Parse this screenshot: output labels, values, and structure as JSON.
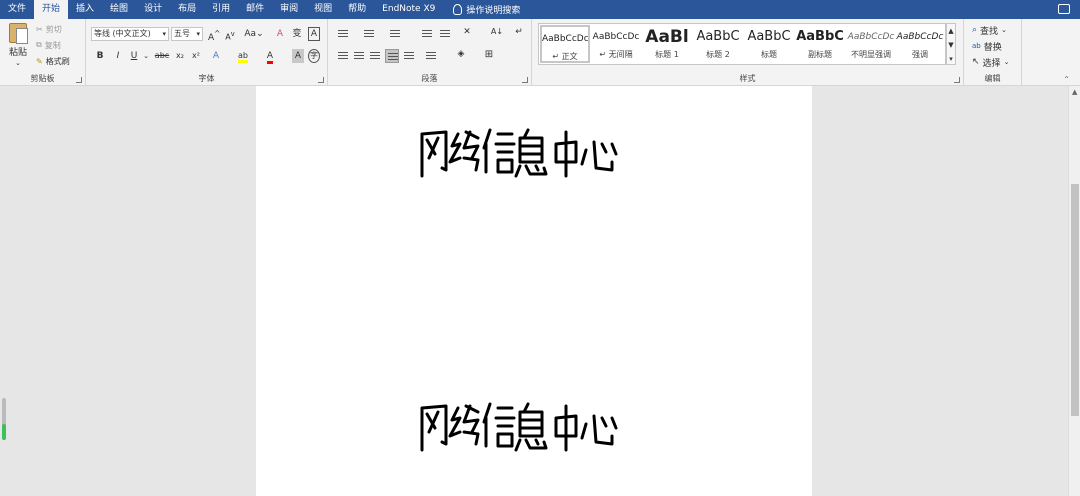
{
  "menu": {
    "tabs": [
      "文件",
      "开始",
      "插入",
      "绘图",
      "设计",
      "布局",
      "引用",
      "邮件",
      "审阅",
      "视图",
      "帮助",
      "EndNote X9"
    ],
    "active_tab": "开始",
    "tell_me": "操作说明搜索"
  },
  "clipboard": {
    "paste": "粘贴",
    "cut": "剪切",
    "copy": "复制",
    "format_painter": "格式刷",
    "label": "剪贴板"
  },
  "font": {
    "font_name": "等线 (中文正文)",
    "font_size": "五号",
    "grow": "A",
    "shrink": "A",
    "change_case": "Aa",
    "clear_format": "A",
    "phonetic": "变",
    "char_border": "A",
    "bold": "B",
    "italic": "I",
    "underline": "U",
    "strikethrough": "abc",
    "subscript": "x₂",
    "superscript": "x²",
    "text_effects": "A",
    "highlight": "ab",
    "font_color": "A",
    "char_shading": "A",
    "enclose": "字",
    "label": "字体"
  },
  "paragraph": {
    "label": "段落",
    "sort": "A↓",
    "show_marks": "↵"
  },
  "styles": {
    "label": "样式",
    "items": [
      {
        "sample": "AaBbCcDc",
        "name": "↵ 正文"
      },
      {
        "sample": "AaBbCcDc",
        "name": "↵ 无间隔"
      },
      {
        "sample": "AaBl",
        "name": "标题 1"
      },
      {
        "sample": "AaBbC",
        "name": "标题 2"
      },
      {
        "sample": "AaBbC",
        "name": "标题"
      },
      {
        "sample": "AaBbC",
        "name": "副标题"
      },
      {
        "sample": "AaBbCcDc",
        "name": "不明显强调"
      },
      {
        "sample": "AaBbCcDc",
        "name": "强调"
      }
    ]
  },
  "editing": {
    "find": "查找",
    "replace": "替换",
    "select": "选择",
    "label": "编辑"
  },
  "document": {
    "signature_text": "网络信息中心"
  },
  "colors": {
    "title_bar": "#2b579a",
    "ribbon": "#f3f3f3",
    "canvas": "#e6e6e6",
    "highlight": "#ffff00",
    "font_color_bar": "#ff0000"
  }
}
